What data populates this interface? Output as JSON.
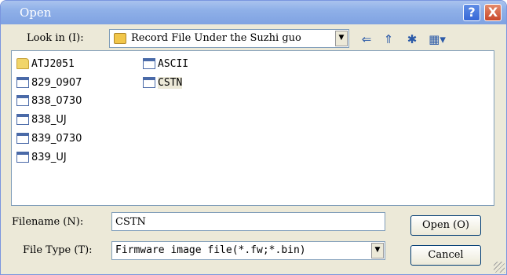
{
  "title": "Open",
  "lookin": {
    "label": "Look in (I):",
    "value": "Record File Under the  Suzhi guo"
  },
  "files": [
    {
      "name": "ATJ2051",
      "type": "folder"
    },
    {
      "name": "829_0907",
      "type": "file"
    },
    {
      "name": "838_0730",
      "type": "file"
    },
    {
      "name": "838_UJ",
      "type": "file"
    },
    {
      "name": "839_0730",
      "type": "file"
    },
    {
      "name": "839_UJ",
      "type": "file"
    },
    {
      "name": "ASCII",
      "type": "file"
    },
    {
      "name": "CSTN",
      "type": "file",
      "selected": true
    }
  ],
  "filename": {
    "label": "Filename (N):",
    "value": "CSTN"
  },
  "filetype": {
    "label": "File Type (T):",
    "value": "Firmware image file(*.fw;*.bin)"
  },
  "buttons": {
    "open": "Open (O)",
    "cancel": "Cancel"
  },
  "titlebar": {
    "help": "?",
    "close": "X"
  }
}
